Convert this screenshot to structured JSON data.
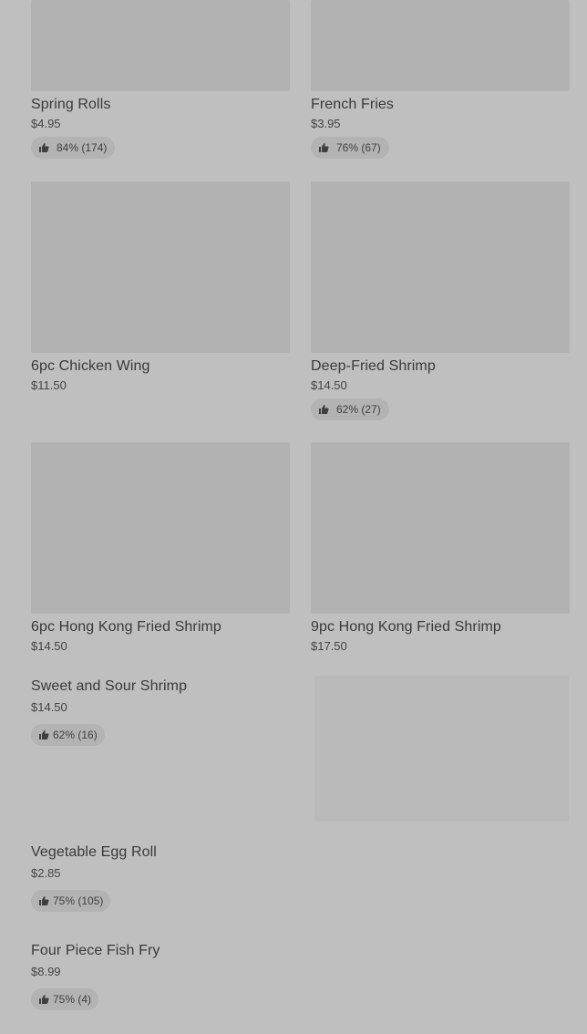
{
  "grid_items": [
    {
      "title": "Spring Rolls",
      "price": "$4.95",
      "rating": "84% (174)"
    },
    {
      "title": "French Fries",
      "price": "$3.95",
      "rating": "76% (67)"
    },
    {
      "title": "6pc Chicken Wing",
      "price": "$11.50",
      "rating": null
    },
    {
      "title": "Deep-Fried Shrimp",
      "price": "$14.50",
      "rating": "62% (27)"
    },
    {
      "title": "6pc Hong Kong Fried Shrimp",
      "price": "$14.50",
      "rating": null
    },
    {
      "title": "9pc Hong Kong Fried Shrimp",
      "price": "$17.50",
      "rating": null
    }
  ],
  "list_items": [
    {
      "title": "Sweet and Sour Shrimp",
      "price": "$14.50",
      "rating": "62% (16)"
    },
    {
      "title": "Vegetable Egg Roll",
      "price": "$2.85",
      "rating": "75% (105)"
    },
    {
      "title": "Four Piece Fish Fry",
      "price": "$8.99",
      "rating": "75% (4)"
    }
  ],
  "icons": {
    "rating_icon": "thumbs-up-icon"
  },
  "colors": {
    "background": "#bfbfbf",
    "image_placeholder": "#b2b2b2",
    "rating_pill": "#b3b3b3",
    "text": "#3b3b3b"
  }
}
